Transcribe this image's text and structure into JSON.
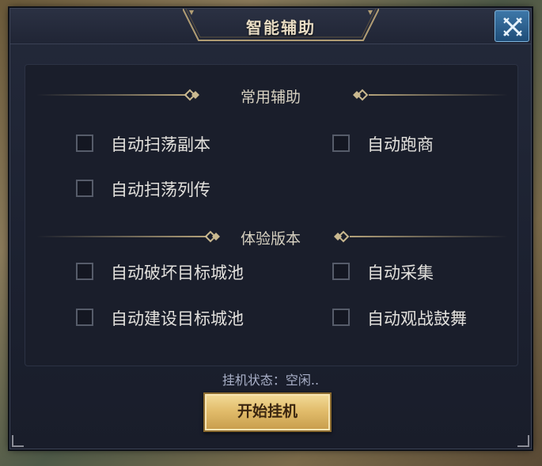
{
  "window": {
    "title": "智能辅助",
    "close_icon": "crossed-swords-close-icon"
  },
  "sections": [
    {
      "label": "常用辅助",
      "options": [
        {
          "label": "自动扫荡副本",
          "checked": false
        },
        {
          "label": "自动跑商",
          "checked": false
        },
        {
          "label": "自动扫荡列传",
          "checked": false
        }
      ]
    },
    {
      "label": "体验版本",
      "options": [
        {
          "label": "自动破坏目标城池",
          "checked": false
        },
        {
          "label": "自动采集",
          "checked": false
        },
        {
          "label": "自动建设目标城池",
          "checked": false
        },
        {
          "label": "自动观战鼓舞",
          "checked": false
        }
      ]
    }
  ],
  "status": {
    "text": "挂机状态：空闲.."
  },
  "start_button": {
    "label": "开始挂机"
  },
  "colors": {
    "panel_bg": "#1c2130",
    "title_text": "#e8dcc4",
    "close_btn": "#2d6494",
    "button_gold": "#e2bd6c",
    "status_text": "#a9b0c8"
  }
}
